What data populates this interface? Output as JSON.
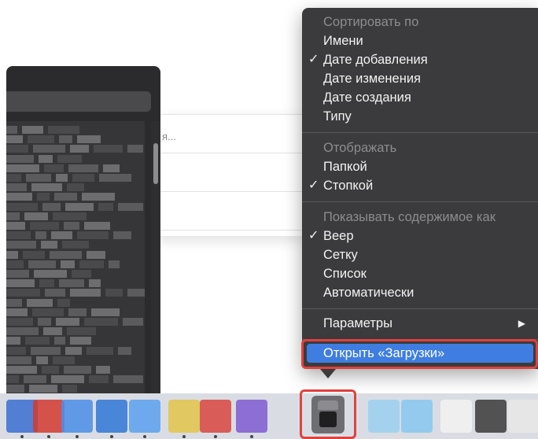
{
  "background": {
    "field_placeholder": "я..."
  },
  "menu": {
    "sort_header": "Сортировать по",
    "sort_items": [
      {
        "label": "Имени",
        "checked": false
      },
      {
        "label": "Дате добавления",
        "checked": true
      },
      {
        "label": "Дате изменения",
        "checked": false
      },
      {
        "label": "Дате создания",
        "checked": false
      },
      {
        "label": "Типу",
        "checked": false
      }
    ],
    "display_header": "Отображать",
    "display_items": [
      {
        "label": "Папкой",
        "checked": false
      },
      {
        "label": "Стопкой",
        "checked": true
      }
    ],
    "content_header": "Показывать содержимое как",
    "content_items": [
      {
        "label": "Веер",
        "checked": true
      },
      {
        "label": "Сетку",
        "checked": false
      },
      {
        "label": "Список",
        "checked": false
      },
      {
        "label": "Автоматически",
        "checked": false
      }
    ],
    "parameters_label": "Параметры",
    "open_label": "Открыть «Загрузки»",
    "check_glyph": "✓",
    "arrow_glyph": "▶"
  },
  "colors": {
    "menu_bg": "#3b3b3d",
    "selected": "#3f7ee0",
    "highlight": "#e0413f"
  },
  "dock": {
    "downloads_icon": "downloads-stack-icon"
  }
}
